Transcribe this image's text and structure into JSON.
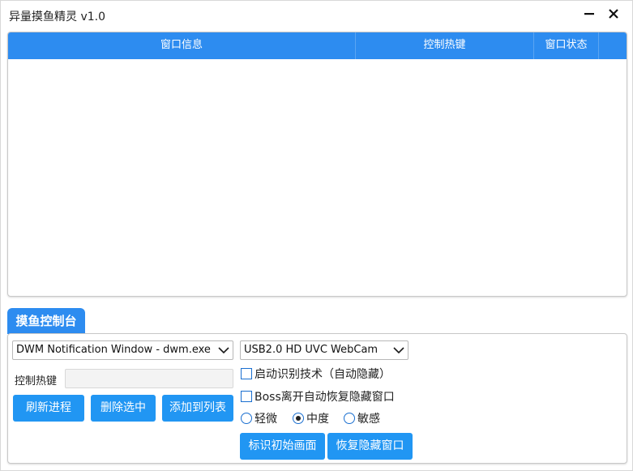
{
  "window": {
    "title": "异量摸鱼精灵 v1.0"
  },
  "table": {
    "columns": [
      "窗口信息",
      "控制热键",
      "窗口状态"
    ],
    "rows": []
  },
  "console": {
    "tab_label": "摸鱼控制台",
    "window_select": {
      "selected": "DWM Notification Window - dwm.exe"
    },
    "camera_select": {
      "selected": "USB2.0 HD UVC WebCam"
    },
    "hotkey_label": "控制热键",
    "hotkey_value": "",
    "buttons": {
      "refresh": "刷新进程",
      "delete": "删除选中",
      "add": "添加到列表",
      "mark": "标识初始画面",
      "restore": "恢复隐藏窗口"
    },
    "checkboxes": [
      {
        "label": "启动识别技术（自动隐藏）",
        "checked": false
      },
      {
        "label": "Boss离开自动恢复隐藏窗口",
        "checked": false
      }
    ],
    "sensitivity": {
      "options": [
        "轻微",
        "中度",
        "敏感"
      ],
      "selected": "中度"
    }
  },
  "colors": {
    "accent": "#2d8cf0",
    "button": "#2196f3"
  }
}
